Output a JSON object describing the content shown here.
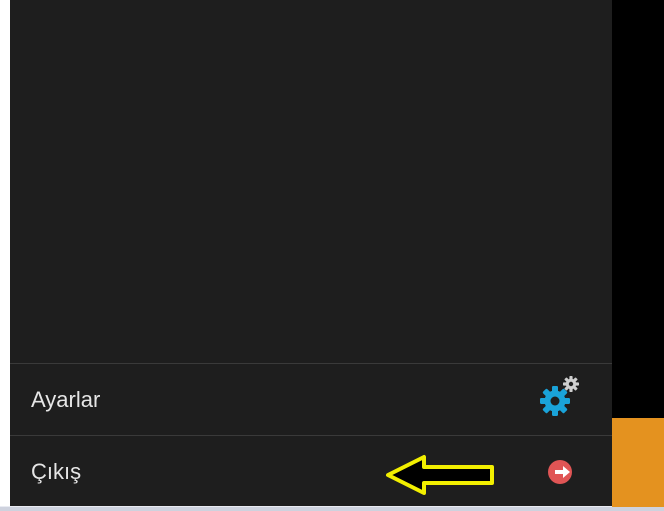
{
  "menu": {
    "items": [
      {
        "label": "Ayarlar",
        "icon": "gears-icon"
      },
      {
        "label": "Çıkış",
        "icon": "logout-icon"
      }
    ]
  },
  "colors": {
    "panel_background": "#1e1e1e",
    "label_text": "#e6e6e6",
    "settings_icon_primary": "#1aa3d9",
    "settings_icon_secondary": "#cfcfcf",
    "logout_icon": "#e05555",
    "annotation_arrow_stroke": "#f2ef00",
    "right_accent": "#e4921f"
  },
  "annotation": {
    "type": "arrow-pointing-left",
    "target": "logout-menu-item"
  }
}
